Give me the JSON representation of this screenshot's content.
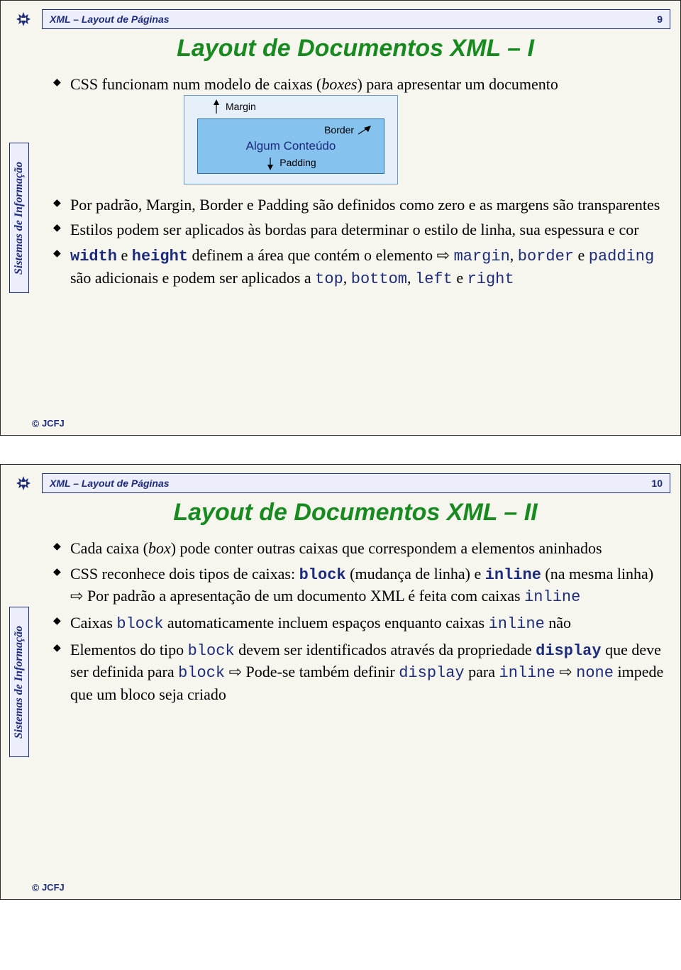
{
  "common": {
    "header_title": "XML  – Layout de Páginas",
    "side_label": "Sistemas de Informação",
    "footer": "JCFJ"
  },
  "slide9": {
    "page_num": "9",
    "title": "Layout de Documentos XML – I",
    "b1_pre": "CSS funcionam num modelo de caixas (",
    "b1_em": "boxes",
    "b1_post": ") para apresentar um documento",
    "diagram": {
      "margin": "Margin",
      "border": "Border",
      "content": "Algum Conteúdo",
      "padding": "Padding"
    },
    "b2": "Por padrão, Margin, Border e Padding são definidos como zero e as margens são transparentes",
    "b3": "Estilos podem ser aplicados às bordas para determinar o estilo de linha, sua espessura e cor",
    "b4": {
      "kw1": "width",
      "t1": " e ",
      "kw2": "height",
      "t2": " definem a área que contém o elemento ",
      "arrow": "⇨",
      "t3": " ",
      "c1": "margin",
      "t4": ", ",
      "c2": "border",
      "t5": " e ",
      "c3": "padding",
      "t6": " são adicionais e podem ser aplicados a ",
      "c4": "top",
      "t7": ", ",
      "c5": "bottom",
      "t8": ", ",
      "c6": "left",
      "t9": " e ",
      "c7": "right"
    }
  },
  "slide10": {
    "page_num": "10",
    "title": "Layout de Documentos XML – II",
    "b1_pre": "Cada caixa (",
    "b1_em": "box",
    "b1_post": ") pode conter outras caixas que correspondem a elementos aninhados",
    "b2": {
      "t1": "CSS reconhece dois tipos de caixas: ",
      "kw1": "block",
      "t2": " (mudança de linha) e ",
      "kw2": "inline",
      "t3": " (na mesma linha) ",
      "arrow": "⇨",
      "t4": " Por padrão a apresentação de um documento XML é feita com caixas ",
      "c1": "inline"
    },
    "b3": {
      "t1": "Caixas  ",
      "c1": "block",
      "t2": "  automaticamente incluem espaços enquanto caixas ",
      "c2": "inline",
      "t3": "  não"
    },
    "b4": {
      "t1": "Elementos do tipo ",
      "c1": "block",
      "t2": "  devem ser identificados através da propriedade ",
      "kw1": "display",
      "t3": " que deve ser definida para ",
      "c2": "block",
      "t4": "  ",
      "arrow": "⇨",
      "t5": " Pode-se também definir ",
      "c3": "display",
      "t6": "  para  ",
      "c4": "inline",
      "t7": "  ",
      "arrow2": "⇨",
      "t8": " ",
      "c5": "none",
      "t9": " impede que um bloco seja criado"
    }
  }
}
